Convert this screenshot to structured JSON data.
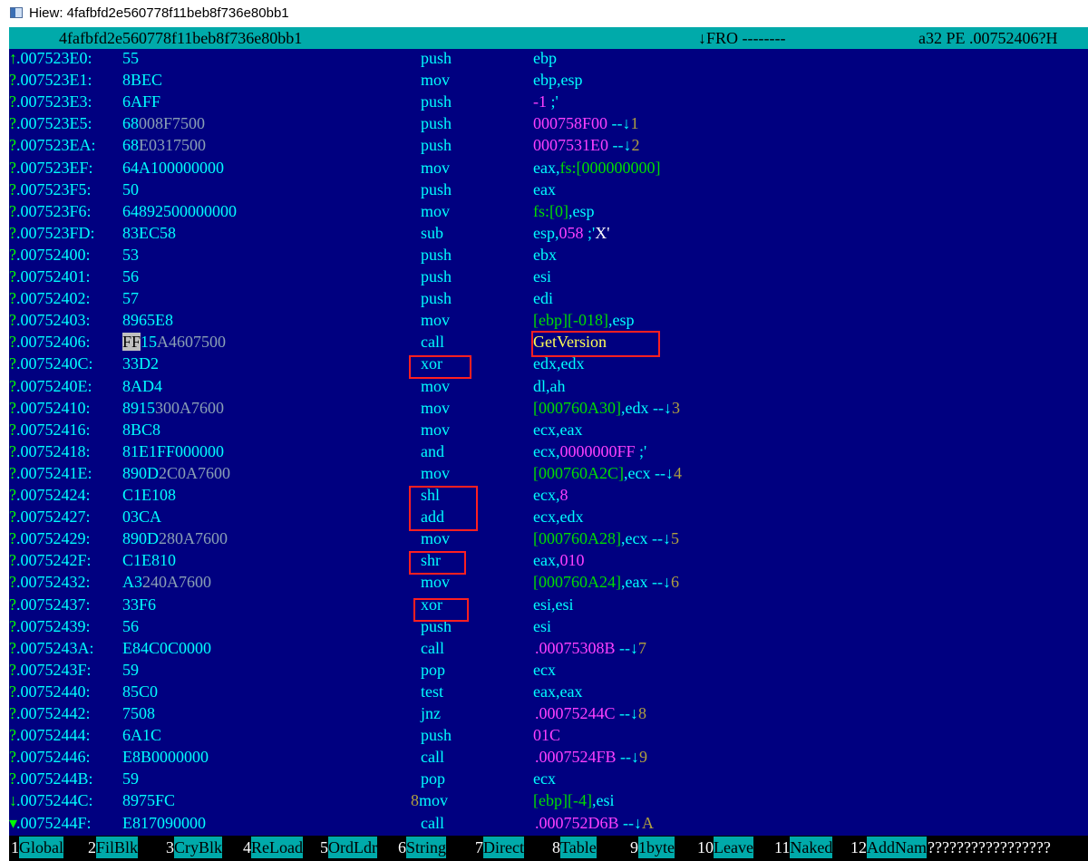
{
  "window": {
    "title": "Hiew: 4fafbfd2e560778f11beb8f736e80bb1"
  },
  "header": {
    "filename": "4fafbfd2e560778f11beb8f736e80bb1",
    "mode": "↓FRO --------",
    "status": "a32 PE .00752406?H"
  },
  "lines": [
    {
      "mark": "↑",
      "addr": ".007523E0:",
      "hex": [
        {
          "t": "55"
        }
      ],
      "mn": "push",
      "op": [
        {
          "t": "ebp"
        }
      ]
    },
    {
      "mark": "?",
      "addr": ".007523E1:",
      "hex": [
        {
          "t": "8BEC"
        }
      ],
      "mn": "mov",
      "op": [
        {
          "t": "ebp,esp"
        }
      ]
    },
    {
      "mark": "?",
      "addr": ".007523E3:",
      "hex": [
        {
          "t": "6AFF"
        }
      ],
      "mn": "push",
      "op": [
        {
          "t": "-1",
          "c": "m"
        },
        {
          "t": " ;'"
        }
      ]
    },
    {
      "mark": "?",
      "addr": ".007523E5:",
      "hex": [
        {
          "t": "68"
        },
        {
          "t": "008F7500",
          "c": "gray"
        }
      ],
      "mn": "push",
      "op": [
        {
          "t": "000758F00",
          "c": "m"
        },
        {
          "t": " --"
        },
        {
          "t": "↓",
          "c": "arr"
        },
        {
          "t": "1",
          "c": "ol"
        }
      ]
    },
    {
      "mark": "?",
      "addr": ".007523EA:",
      "hex": [
        {
          "t": "68"
        },
        {
          "t": "E0317500",
          "c": "gray"
        }
      ],
      "mn": "push",
      "op": [
        {
          "t": "0007531E0",
          "c": "m"
        },
        {
          "t": " --"
        },
        {
          "t": "↓",
          "c": "arr"
        },
        {
          "t": "2",
          "c": "ol"
        }
      ]
    },
    {
      "mark": "?",
      "addr": ".007523EF:",
      "hex": [
        {
          "t": "64A100000000"
        }
      ],
      "mn": "mov",
      "op": [
        {
          "t": "eax,"
        },
        {
          "t": "fs:[000000000]",
          "c": "g"
        }
      ]
    },
    {
      "mark": "?",
      "addr": ".007523F5:",
      "hex": [
        {
          "t": "50"
        }
      ],
      "mn": "push",
      "op": [
        {
          "t": "eax"
        }
      ]
    },
    {
      "mark": "?",
      "addr": ".007523F6:",
      "hex": [
        {
          "t": "64892500000000"
        }
      ],
      "mn": "mov",
      "op": [
        {
          "t": "fs:[0]",
          "c": "g"
        },
        {
          "t": ",esp"
        }
      ]
    },
    {
      "mark": "?",
      "addr": ".007523FD:",
      "hex": [
        {
          "t": "83EC58"
        }
      ],
      "mn": "sub",
      "op": [
        {
          "t": "esp,"
        },
        {
          "t": "058",
          "c": "m"
        },
        {
          "t": " ;'"
        },
        {
          "t": "X'",
          "c": "w"
        }
      ]
    },
    {
      "mark": "?",
      "addr": ".00752400:",
      "hex": [
        {
          "t": "53"
        }
      ],
      "mn": "push",
      "op": [
        {
          "t": "ebx"
        }
      ]
    },
    {
      "mark": "?",
      "addr": ".00752401:",
      "hex": [
        {
          "t": "56"
        }
      ],
      "mn": "push",
      "op": [
        {
          "t": "esi"
        }
      ]
    },
    {
      "mark": "?",
      "addr": ".00752402:",
      "hex": [
        {
          "t": "57"
        }
      ],
      "mn": "push",
      "op": [
        {
          "t": "edi"
        }
      ]
    },
    {
      "mark": "?",
      "addr": ".00752403:",
      "hex": [
        {
          "t": "8965E8"
        }
      ],
      "mn": "mov",
      "op": [
        {
          "t": "[ebp][-018]",
          "c": "g"
        },
        {
          "t": ",esp"
        }
      ]
    },
    {
      "mark": "?",
      "addr": ".00752406:",
      "hex": [
        {
          "t": "FF",
          "c": "hi"
        },
        {
          "t": "15"
        },
        {
          "t": "A4607500",
          "c": "gray"
        }
      ],
      "mn": "call",
      "op": [
        {
          "t": " GetVersion",
          "c": "y"
        }
      ]
    },
    {
      "mark": "?",
      "addr": ".0075240C:",
      "hex": [
        {
          "t": "33D2"
        }
      ],
      "mn": "xor",
      "op": [
        {
          "t": "edx,edx"
        }
      ]
    },
    {
      "mark": "?",
      "addr": ".0075240E:",
      "hex": [
        {
          "t": "8AD4"
        }
      ],
      "mn": "mov",
      "op": [
        {
          "t": "dl,ah"
        }
      ]
    },
    {
      "mark": "?",
      "addr": ".00752410:",
      "hex": [
        {
          "t": "8915"
        },
        {
          "t": "300A7600",
          "c": "gray"
        }
      ],
      "mn": "mov",
      "op": [
        {
          "t": "[000760A30]",
          "c": "g"
        },
        {
          "t": ",edx --"
        },
        {
          "t": "↓",
          "c": "arr"
        },
        {
          "t": "3",
          "c": "ol"
        }
      ]
    },
    {
      "mark": "?",
      "addr": ".00752416:",
      "hex": [
        {
          "t": "8BC8"
        }
      ],
      "mn": "mov",
      "op": [
        {
          "t": "ecx,eax"
        }
      ]
    },
    {
      "mark": "?",
      "addr": ".00752418:",
      "hex": [
        {
          "t": "81E1FF000000"
        }
      ],
      "mn": "and",
      "op": [
        {
          "t": "ecx,"
        },
        {
          "t": "0000000FF",
          "c": "m"
        },
        {
          "t": " ;'"
        }
      ]
    },
    {
      "mark": "?",
      "addr": ".0075241E:",
      "hex": [
        {
          "t": "890D"
        },
        {
          "t": "2C0A7600",
          "c": "gray"
        }
      ],
      "mn": "mov",
      "op": [
        {
          "t": "[000760A2C]",
          "c": "g"
        },
        {
          "t": ",ecx --"
        },
        {
          "t": "↓",
          "c": "arr"
        },
        {
          "t": "4",
          "c": "ol"
        }
      ]
    },
    {
      "mark": "?",
      "addr": ".00752424:",
      "hex": [
        {
          "t": "C1E108"
        }
      ],
      "mn": "shl",
      "op": [
        {
          "t": "ecx,"
        },
        {
          "t": "8",
          "c": "m"
        }
      ]
    },
    {
      "mark": "?",
      "addr": ".00752427:",
      "hex": [
        {
          "t": "03CA"
        }
      ],
      "mn": "add",
      "op": [
        {
          "t": "ecx,edx"
        }
      ]
    },
    {
      "mark": "?",
      "addr": ".00752429:",
      "hex": [
        {
          "t": "890D"
        },
        {
          "t": "280A7600",
          "c": "gray"
        }
      ],
      "mn": "mov",
      "op": [
        {
          "t": "[000760A28]",
          "c": "g"
        },
        {
          "t": ",ecx --"
        },
        {
          "t": "↓",
          "c": "arr"
        },
        {
          "t": "5",
          "c": "ol"
        }
      ]
    },
    {
      "mark": "?",
      "addr": ".0075242F:",
      "hex": [
        {
          "t": "C1E810"
        }
      ],
      "mn": "shr",
      "op": [
        {
          "t": "eax,"
        },
        {
          "t": "010",
          "c": "m"
        }
      ]
    },
    {
      "mark": "?",
      "addr": ".00752432:",
      "hex": [
        {
          "t": "A3"
        },
        {
          "t": "240A7600",
          "c": "gray"
        }
      ],
      "mn": "mov",
      "op": [
        {
          "t": "[000760A24]",
          "c": "g"
        },
        {
          "t": ",eax --"
        },
        {
          "t": "↓",
          "c": "arr"
        },
        {
          "t": "6",
          "c": "ol"
        }
      ]
    },
    {
      "mark": "?",
      "addr": ".00752437:",
      "hex": [
        {
          "t": "33F6"
        }
      ],
      "mn": "xor",
      "op": [
        {
          "t": "esi,esi"
        }
      ]
    },
    {
      "mark": "?",
      "addr": ".00752439:",
      "hex": [
        {
          "t": "56"
        }
      ],
      "mn": "push",
      "op": [
        {
          "t": "esi"
        }
      ]
    },
    {
      "mark": "?",
      "addr": ".0075243A:",
      "hex": [
        {
          "t": "E84C0C0000"
        }
      ],
      "mn": "call",
      "op": [
        {
          "t": ".00075308B",
          "c": "m"
        },
        {
          "t": " --"
        },
        {
          "t": "↓",
          "c": "arr"
        },
        {
          "t": "7",
          "c": "ol"
        }
      ]
    },
    {
      "mark": "?",
      "addr": ".0075243F:",
      "hex": [
        {
          "t": "59"
        }
      ],
      "mn": "pop",
      "op": [
        {
          "t": "ecx"
        }
      ]
    },
    {
      "mark": "?",
      "addr": ".00752440:",
      "hex": [
        {
          "t": "85C0"
        }
      ],
      "mn": "test",
      "op": [
        {
          "t": "eax,eax"
        }
      ]
    },
    {
      "mark": "?",
      "addr": ".00752442:",
      "hex": [
        {
          "t": "7508"
        }
      ],
      "mn": "jnz",
      "op": [
        {
          "t": ".00075244C",
          "c": "m"
        },
        {
          "t": " --"
        },
        {
          "t": "↓",
          "c": "arr"
        },
        {
          "t": "8",
          "c": "ol"
        }
      ]
    },
    {
      "mark": "?",
      "addr": ".00752444:",
      "hex": [
        {
          "t": "6A1C"
        }
      ],
      "mn": "push",
      "op": [
        {
          "t": "01C",
          "c": "m"
        }
      ]
    },
    {
      "mark": "?",
      "addr": ".00752446:",
      "hex": [
        {
          "t": "E8B0000000"
        }
      ],
      "mn": "call",
      "op": [
        {
          "t": ".0007524FB",
          "c": "m"
        },
        {
          "t": " --"
        },
        {
          "t": "↓",
          "c": "arr"
        },
        {
          "t": "9",
          "c": "ol"
        }
      ]
    },
    {
      "mark": "?",
      "addr": ".0075244B:",
      "hex": [
        {
          "t": "59"
        }
      ],
      "mn": "pop",
      "op": [
        {
          "t": "ecx"
        }
      ]
    },
    {
      "mark": "↓",
      "addr": ".0075244C:",
      "hex": [
        {
          "t": "8975FC"
        }
      ],
      "flag": "8",
      "mn": "mov",
      "op": [
        {
          "t": "[ebp][-4]",
          "c": "g"
        },
        {
          "t": ",esi"
        }
      ]
    },
    {
      "mark": "▾",
      "addr": ".0075244F:",
      "hex": [
        {
          "t": "E817090000"
        }
      ],
      "mn": "call",
      "op": [
        {
          "t": ".000752D6B",
          "c": "m"
        },
        {
          "t": " --"
        },
        {
          "t": "↓",
          "c": "arr"
        },
        {
          "t": "A",
          "c": "ol"
        }
      ]
    }
  ],
  "fkeys": [
    {
      "num": "1",
      "label": "Global"
    },
    {
      "num": "2",
      "label": "FilBlk"
    },
    {
      "num": "3",
      "label": "CryBlk"
    },
    {
      "num": "4",
      "label": "ReLoad"
    },
    {
      "num": "5",
      "label": "OrdLdr"
    },
    {
      "num": "6",
      "label": "String"
    },
    {
      "num": "7",
      "label": "Direct"
    },
    {
      "num": "8",
      "label": "Table "
    },
    {
      "num": "9",
      "label": "1byte "
    },
    {
      "num": "10",
      "label": "Leave "
    },
    {
      "num": "11",
      "label": "Naked "
    },
    {
      "num": "12",
      "label": "AddNam"
    }
  ],
  "fkeys_trailer": "?????????????????",
  "highlight_color": "#ff2020"
}
